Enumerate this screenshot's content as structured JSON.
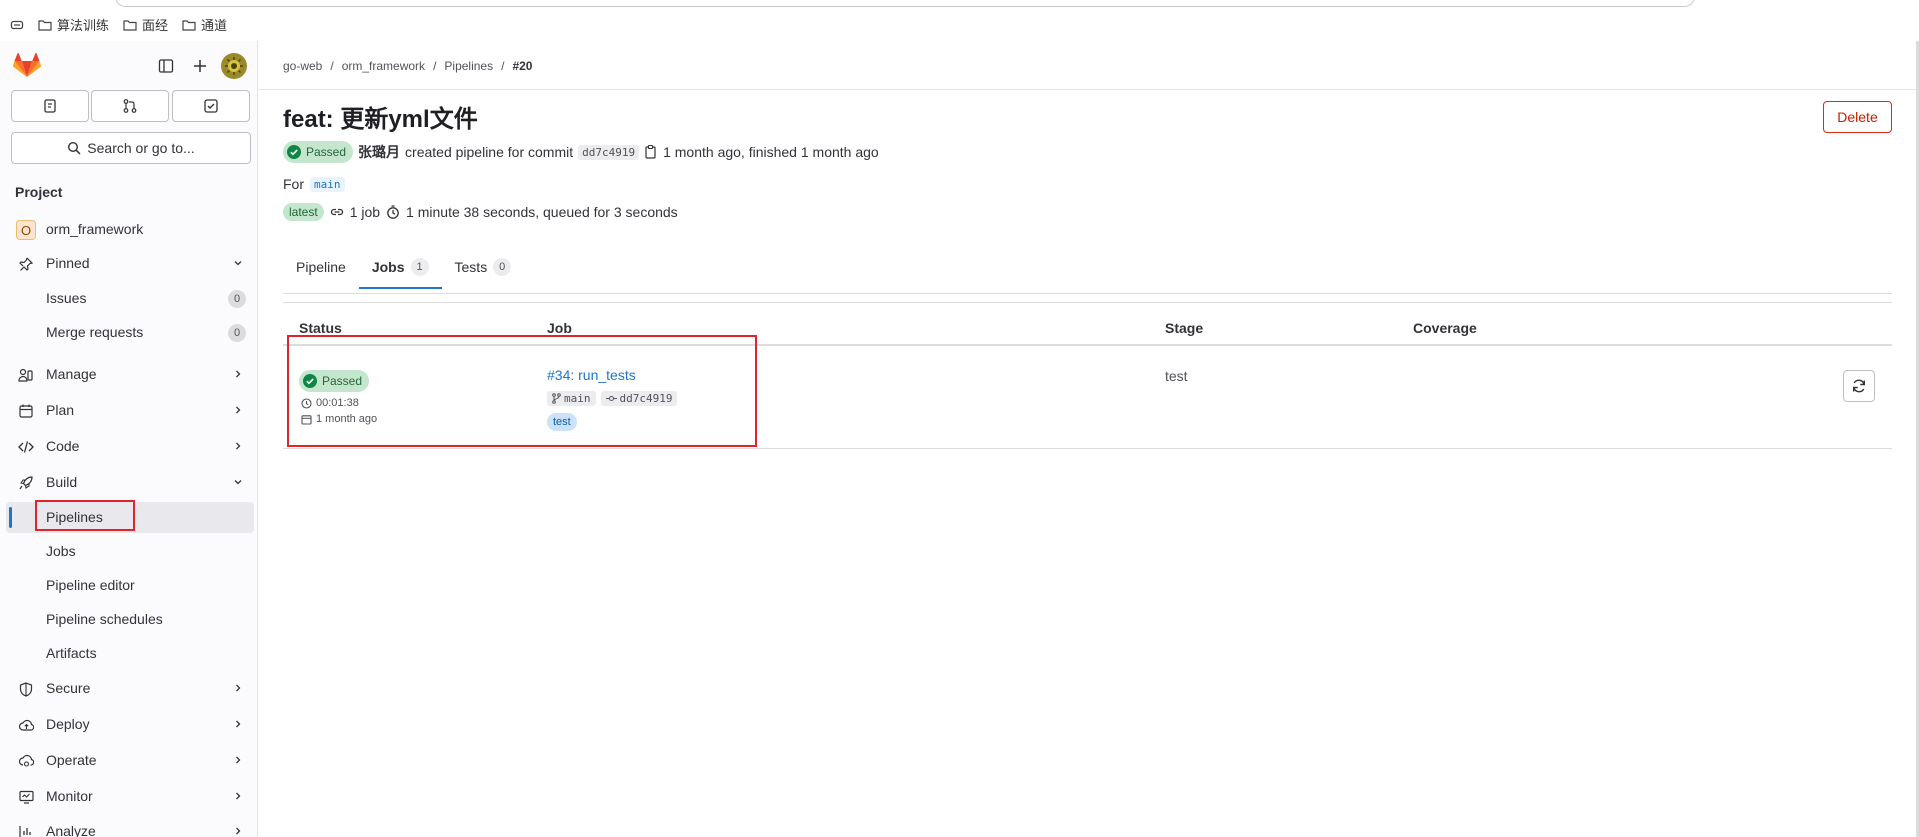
{
  "bookmarks": [
    {
      "label": "算法训练",
      "icon": "folder-icon"
    },
    {
      "label": "面经",
      "icon": "folder-icon"
    },
    {
      "label": "通道",
      "icon": "folder-icon"
    }
  ],
  "sidebar": {
    "search_label": "Search or go to...",
    "section_title": "Project",
    "project_initial": "O",
    "project_name": "orm_framework",
    "pinned": "Pinned",
    "issues": {
      "label": "Issues",
      "count": "0"
    },
    "merge_requests": {
      "label": "Merge requests",
      "count": "0"
    },
    "manage": "Manage",
    "plan": "Plan",
    "code": "Code",
    "build": "Build",
    "build_items": [
      "Pipelines",
      "Jobs",
      "Pipeline editor",
      "Pipeline schedules",
      "Artifacts"
    ],
    "secure": "Secure",
    "deploy": "Deploy",
    "operate": "Operate",
    "monitor": "Monitor",
    "analyze": "Analyze"
  },
  "breadcrumb": [
    "go-web",
    "orm_framework",
    "Pipelines",
    "#20"
  ],
  "pipeline": {
    "title": "feat: 更新yml文件",
    "delete_label": "Delete",
    "status": "Passed",
    "author": "张璐月",
    "created_text": "created pipeline for commit",
    "commit": "dd7c4919",
    "timing": "1 month ago, finished 1 month ago",
    "for_label": "For",
    "branch": "main",
    "latest_badge": "latest",
    "jobs_count_text": "1 job",
    "duration_text": "1 minute 38 seconds, queued for 3 seconds"
  },
  "tabs": [
    {
      "label": "Pipeline",
      "count": ""
    },
    {
      "label": "Jobs",
      "count": "1"
    },
    {
      "label": "Tests",
      "count": "0"
    }
  ],
  "table": {
    "headers": [
      "Status",
      "Job",
      "Stage",
      "Coverage"
    ],
    "rows": [
      {
        "status": "Passed",
        "duration": "00:01:38",
        "finished": "1 month ago",
        "job": "#34: run_tests",
        "branch": "main",
        "commit": "dd7c4919",
        "stage_badge": "test",
        "stage": "test",
        "coverage": ""
      }
    ]
  },
  "colors": {
    "accent": "#1f75cb",
    "success_bg": "#c3e6cd",
    "success_fg": "#24663b",
    "danger": "#dd2b0e",
    "highlight": "#e0242b"
  }
}
